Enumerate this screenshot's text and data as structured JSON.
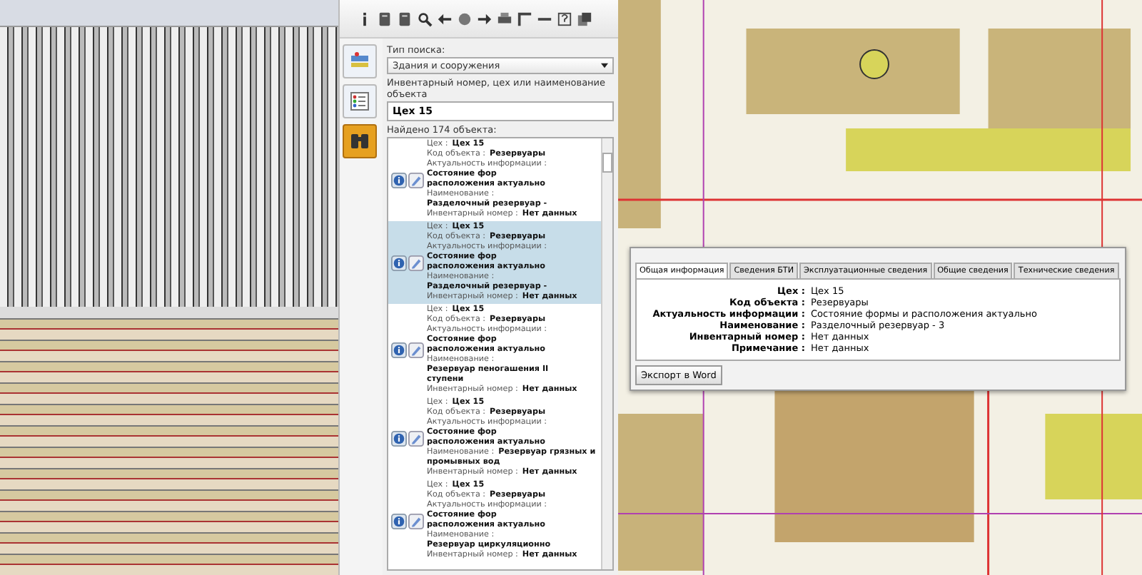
{
  "search_panel": {
    "type_label": "Тип поиска:",
    "type_value": "Здания и сооружения",
    "query_label": "Инвентарный номер, цех или наименование объекта",
    "query_value": "Цех 15",
    "found": "Найдено 174 объекта:"
  },
  "side_tools": [
    {
      "kind": "layers",
      "selected": false
    },
    {
      "kind": "legend",
      "selected": false
    },
    {
      "kind": "search",
      "selected": true
    }
  ],
  "results": [
    {
      "selected": false,
      "fields": [
        {
          "label": "Цех :",
          "value": "Цех 15"
        },
        {
          "label": "Код объекта :",
          "value": "Резервуары"
        },
        {
          "label": "Актуальность информации :",
          "value": "Состояние фор",
          "value_line2": "расположения актуально"
        },
        {
          "label": "Наименование :",
          "value": "Разделочный резервуар -"
        },
        {
          "label": "Инвентарный номер :",
          "value": "Нет данных"
        }
      ]
    },
    {
      "selected": true,
      "fields": [
        {
          "label": "Цех :",
          "value": "Цех 15"
        },
        {
          "label": "Код объекта :",
          "value": "Резервуары"
        },
        {
          "label": "Актуальность информации :",
          "value": "Состояние фор",
          "value_line2": "расположения актуально"
        },
        {
          "label": "Наименование :",
          "value": "Разделочный резервуар -"
        },
        {
          "label": "Инвентарный номер :",
          "value": "Нет данных"
        }
      ]
    },
    {
      "selected": false,
      "fields": [
        {
          "label": "Цех :",
          "value": "Цех 15"
        },
        {
          "label": "Код объекта :",
          "value": "Резервуары"
        },
        {
          "label": "Актуальность информации :",
          "value": "Состояние фор",
          "value_line2": "расположения актуально"
        },
        {
          "label": "Наименование :",
          "value": "Резервуар пеногашения II",
          "value_line2": "ступени"
        },
        {
          "label": "Инвентарный номер :",
          "value": "Нет данных"
        }
      ]
    },
    {
      "selected": false,
      "fields": [
        {
          "label": "Цех :",
          "value": "Цех 15"
        },
        {
          "label": "Код объекта :",
          "value": "Резервуары"
        },
        {
          "label": "Актуальность информации :",
          "value": "Состояние фор",
          "value_line2": "расположения актуально"
        },
        {
          "label": "Наименование :",
          "value": "Резервуар грязных и",
          "value_line2": "промывных вод"
        },
        {
          "label": "Инвентарный номер :",
          "value": "Нет данных"
        }
      ]
    },
    {
      "selected": false,
      "fields": [
        {
          "label": "Цех :",
          "value": "Цех 15"
        },
        {
          "label": "Код объекта :",
          "value": "Резервуары"
        },
        {
          "label": "Актуальность информации :",
          "value": "Состояние фор",
          "value_line2": "расположения актуально"
        },
        {
          "label": "Наименование :",
          "value": "Резервуар циркуляционно"
        },
        {
          "label": "Инвентарный номер :",
          "value": "Нет данных"
        }
      ]
    }
  ],
  "info_window": {
    "tabs": [
      {
        "label": "Общая информация",
        "selected": true
      },
      {
        "label": "Сведения БТИ",
        "selected": false
      },
      {
        "label": "Эксплуатационные сведения",
        "selected": false
      },
      {
        "label": "Общие сведения",
        "selected": false
      },
      {
        "label": "Технические сведения",
        "selected": false
      }
    ],
    "rows": [
      {
        "label": "Цех :",
        "value": "Цех 15"
      },
      {
        "label": "Код объекта :",
        "value": "Резервуары"
      },
      {
        "label": "Актуальность информации :",
        "value": "Состояние формы и расположения актуально"
      },
      {
        "label": "Наименование :",
        "value": "Разделочный резервуар - 3"
      },
      {
        "label": "Инвентарный номер :",
        "value": "Нет данных"
      },
      {
        "label": "Примечание :",
        "value": "Нет данных"
      }
    ],
    "export_button": "Экспорт в Word"
  }
}
